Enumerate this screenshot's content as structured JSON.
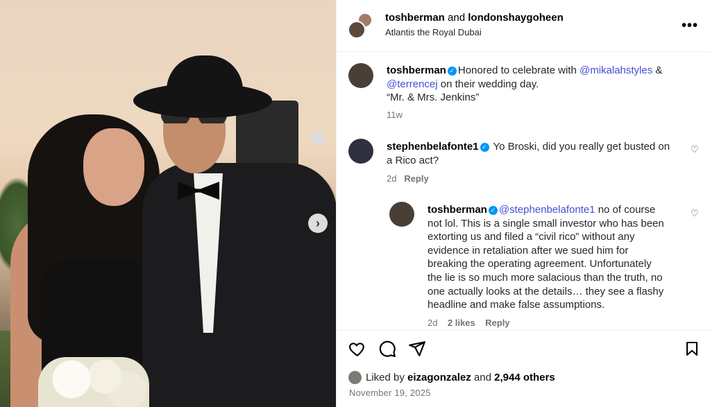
{
  "post": {
    "header": {
      "user1": "toshberman",
      "joiner": "and",
      "user2": "londonshaygoheen",
      "location": "Atlantis the Royal Dubai"
    },
    "caption": {
      "user": "toshberman",
      "t1": "Honored to celebrate with ",
      "m1": "@mikalahstyles",
      "t2": " &",
      "m2": "@terrencej",
      "t3": " on their wedding day.",
      "t4": "“Mr. & Mrs. Jenkins”",
      "time": "11w"
    },
    "comment1": {
      "user": "stephenbelafonte1",
      "line1": "Yo Broski, did you really get busted on",
      "line2": "a Rico act?",
      "time": "2d",
      "reply": "Reply"
    },
    "reply1": {
      "user": "toshberman",
      "mention": "@stephenbelafonte1",
      "l1": " no of course",
      "l2": "not lol. This is a single small investor who has been",
      "l3": "extorting us and filed a “civil rico” without any",
      "l4": "evidence in retaliation after we sued him for",
      "l5": "breaking the operating agreement. Unfortunately",
      "l6": "the lie is so much more salacious than the truth, no",
      "l7": "one actually looks at the details… they see a flashy",
      "l8": "headline and make false assumptions.",
      "time": "2d",
      "likes": "2 likes",
      "reply": "Reply"
    },
    "liked_by": {
      "prefix": "Liked by ",
      "user": "eizagonzalez",
      "mid": " and ",
      "count": "2,944 others"
    },
    "date": "November 19, 2025"
  }
}
